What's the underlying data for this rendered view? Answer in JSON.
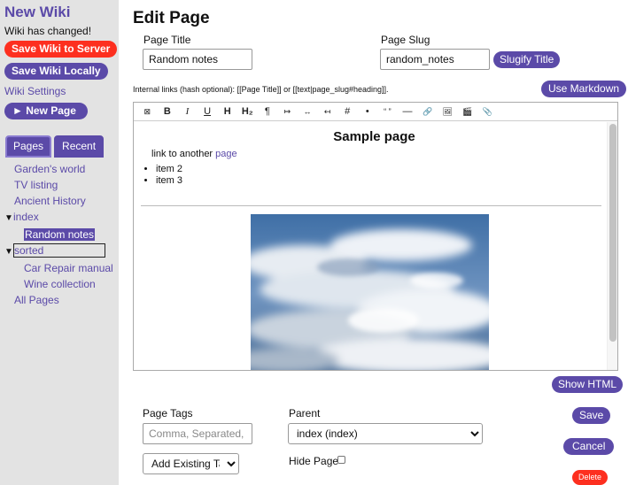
{
  "sidebar": {
    "wiki_title": "New Wiki",
    "changed_text": "Wiki has changed!",
    "save_server_label": "Save Wiki to Server",
    "save_local_label": "Save Wiki Locally",
    "settings_label": "Wiki Settings",
    "new_page_label": "► New Page",
    "tabs": {
      "pages": "Pages",
      "recent": "Recent"
    },
    "tree": {
      "gardens_world": "Garden's world",
      "tv_listing": "TV listing",
      "ancient_history": "Ancient History",
      "index": "index",
      "random_notes": "Random notes",
      "sorted": "sorted",
      "car_repair": "Car Repair manual",
      "wine_collection": "Wine collection",
      "all_pages": "All Pages"
    },
    "toggle_arrow": "▼"
  },
  "editor_page": {
    "heading": "Edit Page",
    "title_label": "Page Title",
    "title_value": "Random notes",
    "slug_label": "Page Slug",
    "slug_value": "random_notes",
    "slugify_label": "Slugify Title",
    "hint": "Internal links (hash optional): [[Page Title]] or [[text|page_slug#heading]].",
    "use_markdown_label": "Use Markdown",
    "toolbar": {
      "clear": "⊠",
      "bold": "B",
      "italic": "I",
      "underline": "U",
      "heading": "H",
      "heading2": "H₂",
      "paragraph": "¶",
      "indent": "↦",
      "align": "↔",
      "outdent": "↤",
      "hash": "#",
      "bullet": "•",
      "quote": "“ ”",
      "rule": "—",
      "link": "🔗",
      "image": "🖼",
      "media": "🎬",
      "attach": "📎"
    },
    "content": {
      "heading": "Sample page",
      "link_prefix": "link to another ",
      "link_text": "page",
      "items": [
        "item 2",
        "item 3"
      ]
    },
    "show_html_label": "Show HTML",
    "tags_label": "Page Tags",
    "tags_placeholder": "Comma, Separated, List",
    "add_tag_label": "Add Existing Tag",
    "parent_label": "Parent",
    "parent_value": "index (index)",
    "hide_page_label": "Hide Page",
    "save_label": "Save",
    "cancel_label": "Cancel",
    "delete_label": "Delete"
  },
  "colors": {
    "accent": "#5b4aa8",
    "danger": "#fd2f1f",
    "sidebar_bg": "#e3e3e3"
  }
}
